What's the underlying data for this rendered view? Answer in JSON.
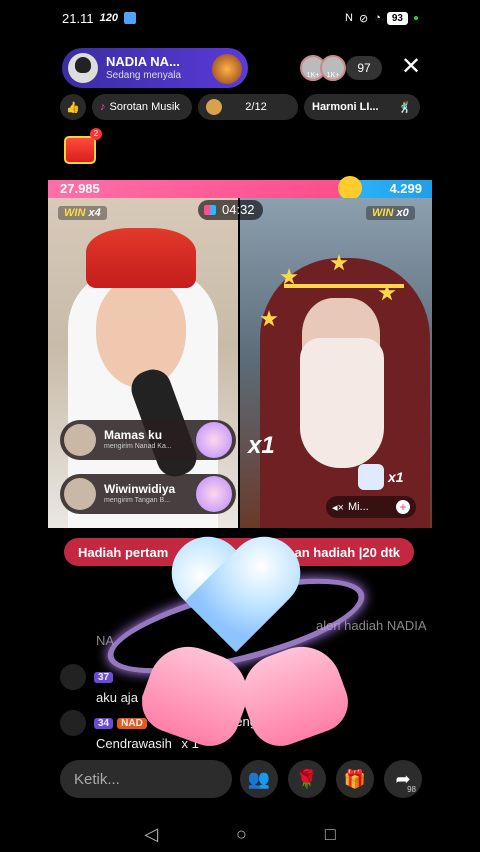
{
  "status_bar": {
    "time": "21.11",
    "network_speed": "120",
    "battery": "93"
  },
  "host": {
    "name": "NADIA NA...",
    "subtitle": "Sedang menyala"
  },
  "viewers": {
    "count": "97",
    "avatar_labels": [
      "1K+",
      "1K+"
    ]
  },
  "chips": [
    {
      "icon": "thumbs-up-icon",
      "label": ""
    },
    {
      "icon": "music-note-icon",
      "label": "Sorotan Musik"
    },
    {
      "icon": "rank-icon",
      "label": "2/12"
    },
    {
      "icon": "user-icon",
      "label": "Harmoni LI..."
    }
  ],
  "gift_box": {
    "badge": "2"
  },
  "battle": {
    "score_left": "27.985",
    "score_right": "4.299",
    "timer": "04:32",
    "win_left_label": "WIN",
    "win_left_count": "x4",
    "win_right_label": "WIN",
    "win_right_count": "x0",
    "multiplier": "x1",
    "swan_count": "x1",
    "mini_pill_label": "Mi...",
    "gifters": [
      {
        "name": "Mamas ku",
        "message": "mengirim Nanad Ka..."
      },
      {
        "name": "Wiwinwidiya",
        "message": "mengirim Tangan B..."
      }
    ]
  },
  "first_gift_banner": {
    "left": "Hadiah pertam",
    "right": "an hadiah  |20 dtk"
  },
  "chat": [
    {
      "text": "aleri hadiah NADIA",
      "extra": "NA"
    },
    {
      "level": "37",
      "text": "aku aja C",
      "tail": "ak k"
    },
    {
      "level": "34",
      "tag": "NAD",
      "text": "mengirim",
      "line2": "Cendrawasih",
      "tail2": "x 1"
    }
  ],
  "input": {
    "placeholder": "Ketik..."
  },
  "actions": [
    {
      "icon": "group-icon"
    },
    {
      "icon": "rose-icon"
    },
    {
      "icon": "gift-icon"
    },
    {
      "icon": "share-icon",
      "count": "98"
    }
  ],
  "nav": {
    "back": "◁",
    "home": "○",
    "recents": "□"
  },
  "colors": {
    "score_left": "#ff4e8c",
    "score_right": "#1e9fe8",
    "host_pill": "#4a34c0",
    "banner": "#c2283f"
  }
}
